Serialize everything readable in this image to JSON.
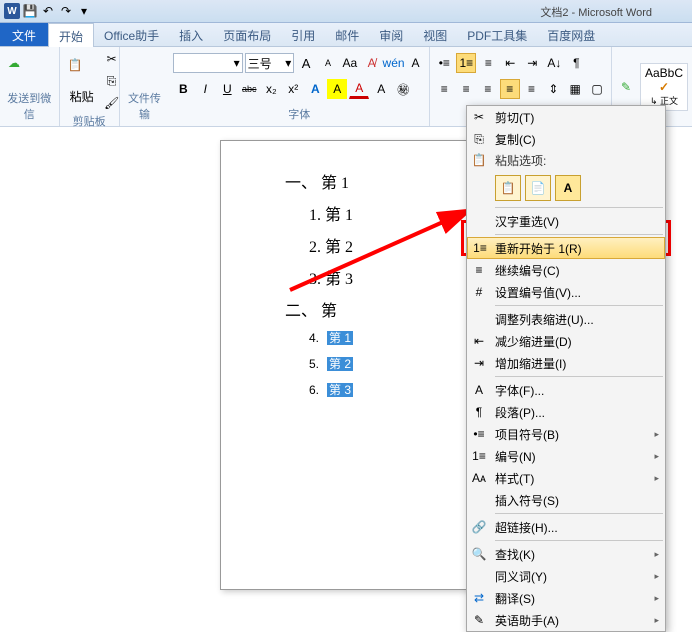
{
  "app": {
    "title": "文档2 - Microsoft Word",
    "word_glyph": "W"
  },
  "qat": {
    "save": "💾",
    "undo": "↶",
    "redo": "↷"
  },
  "menu": {
    "file": "文件",
    "tabs": [
      "开始",
      "Office助手",
      "插入",
      "页面布局",
      "引用",
      "邮件",
      "审阅",
      "视图",
      "PDF工具集",
      "百度网盘"
    ]
  },
  "ribbon": {
    "wechat": {
      "label": "发送到微信"
    },
    "clipboard": {
      "paste": "粘贴",
      "label": "剪贴板"
    },
    "filetrans": {
      "label": "文件传输"
    },
    "font": {
      "size": "三号",
      "grow": "A",
      "shrink": "A",
      "clear": "Aa",
      "b": "B",
      "i": "I",
      "u": "U",
      "strike": "abc",
      "sub": "x₂",
      "sup": "x²",
      "hi": "A",
      "color": "A",
      "label": "字体",
      "w": "wén",
      "aa": "Aa",
      "a_box": "A",
      "circ": "㊙"
    },
    "para": {
      "bul": "≡",
      "num": "≡",
      "ml": "≡",
      "dec": "≡",
      "inc": "≡",
      "al1": "≡",
      "al2": "≡",
      "al3": "≡",
      "al4": "≡",
      "line": "≡",
      "fill": "▦",
      "bord": "▢"
    },
    "styles": {
      "preview": "AaBbC",
      "normal": "↳ 正文"
    }
  },
  "doc": {
    "h1": "一、 第 1",
    "l1": "1.  第 1",
    "l2": "2.  第 2",
    "l3": "3.  第 3",
    "h2": "二、 第",
    "l4_num": "4.",
    "l4_txt": "第 1",
    "l5_num": "5.",
    "l5_txt": "第 2",
    "l6_num": "6.",
    "l6_txt": "第 3"
  },
  "cm": {
    "cut": "剪切(T)",
    "copy": "复制(C)",
    "paste_label": "粘贴选项:",
    "hanzi": "汉字重选(V)",
    "restart": "重新开始于 1(R)",
    "continue": "继续编号(C)",
    "setnum": "设置编号值(V)...",
    "adjust": "调整列表缩进(U)...",
    "dec": "减少缩进量(D)",
    "inc": "增加缩进量(I)",
    "font": "字体(F)...",
    "para": "段落(P)...",
    "bullets": "项目符号(B)",
    "numbering": "编号(N)",
    "styles": "样式(T)",
    "insym": "插入符号(S)",
    "link": "超链接(H)...",
    "find": "查找(K)",
    "syn": "同义词(Y)",
    "trans": "翻译(S)",
    "eng": "英语助手(A)",
    "arrow": "▸"
  }
}
